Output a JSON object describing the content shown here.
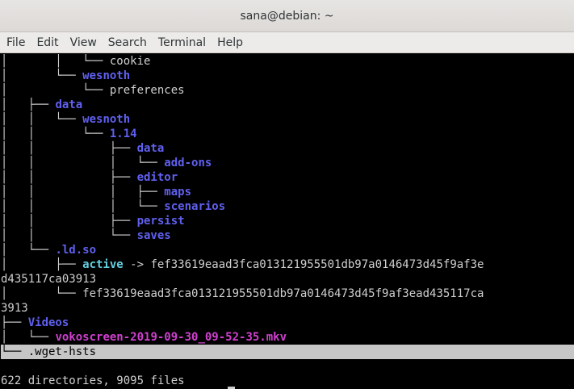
{
  "window": {
    "title": "sana@debian: ~"
  },
  "menubar": {
    "items": [
      "File",
      "Edit",
      "View",
      "Search",
      "Terminal",
      "Help"
    ]
  },
  "terminal": {
    "lines": [
      [
        {
          "t": "│       │   └── ",
          "c": "t"
        },
        {
          "t": "cookie",
          "c": "t"
        }
      ],
      [
        {
          "t": "│       └── ",
          "c": "t"
        },
        {
          "t": "wesnoth",
          "c": "d"
        }
      ],
      [
        {
          "t": "│           └── ",
          "c": "t"
        },
        {
          "t": "preferences",
          "c": "t"
        }
      ],
      [
        {
          "t": "│   ├── ",
          "c": "t"
        },
        {
          "t": "data",
          "c": "d"
        }
      ],
      [
        {
          "t": "│   │   └── ",
          "c": "t"
        },
        {
          "t": "wesnoth",
          "c": "d"
        }
      ],
      [
        {
          "t": "│   │       └── ",
          "c": "t"
        },
        {
          "t": "1.14",
          "c": "d"
        }
      ],
      [
        {
          "t": "│   │           ├── ",
          "c": "t"
        },
        {
          "t": "data",
          "c": "d"
        }
      ],
      [
        {
          "t": "│   │           │   └── ",
          "c": "t"
        },
        {
          "t": "add-ons",
          "c": "d"
        }
      ],
      [
        {
          "t": "│   │           ├── ",
          "c": "t"
        },
        {
          "t": "editor",
          "c": "d"
        }
      ],
      [
        {
          "t": "│   │           │   ├── ",
          "c": "t"
        },
        {
          "t": "maps",
          "c": "d"
        }
      ],
      [
        {
          "t": "│   │           │   └── ",
          "c": "t"
        },
        {
          "t": "scenarios",
          "c": "d"
        }
      ],
      [
        {
          "t": "│   │           ├── ",
          "c": "t"
        },
        {
          "t": "persist",
          "c": "d"
        }
      ],
      [
        {
          "t": "│   │           └── ",
          "c": "t"
        },
        {
          "t": "saves",
          "c": "d"
        }
      ],
      [
        {
          "t": "│   └── ",
          "c": "t"
        },
        {
          "t": ".ld.so",
          "c": "d"
        }
      ],
      [
        {
          "t": "│       ├── ",
          "c": "t"
        },
        {
          "t": "active",
          "c": "l"
        },
        {
          "t": " -> fef33619eaad3fca013121955501db97a0146473d45f9af3e",
          "c": "t"
        }
      ],
      [
        {
          "t": "d435117ca03913",
          "c": "t"
        }
      ],
      [
        {
          "t": "│       └── ",
          "c": "t"
        },
        {
          "t": "fef33619eaad3fca013121955501db97a0146473d45f9af3ead435117ca",
          "c": "t"
        }
      ],
      [
        {
          "t": "3913",
          "c": "t"
        }
      ],
      [
        {
          "t": "├── ",
          "c": "t"
        },
        {
          "t": "Videos",
          "c": "d"
        }
      ],
      [
        {
          "t": "│   └── ",
          "c": "t"
        },
        {
          "t": "vokoscreen-2019-09-30_09-52-35.mkv",
          "c": "m"
        }
      ],
      [
        {
          "t": "└── ",
          "c": "t"
        },
        {
          "t": ".wget-hsts",
          "c": "t"
        }
      ],
      [],
      [
        {
          "t": "622 directories, 9095 files",
          "c": "t"
        }
      ]
    ],
    "highlight_line": 20
  }
}
